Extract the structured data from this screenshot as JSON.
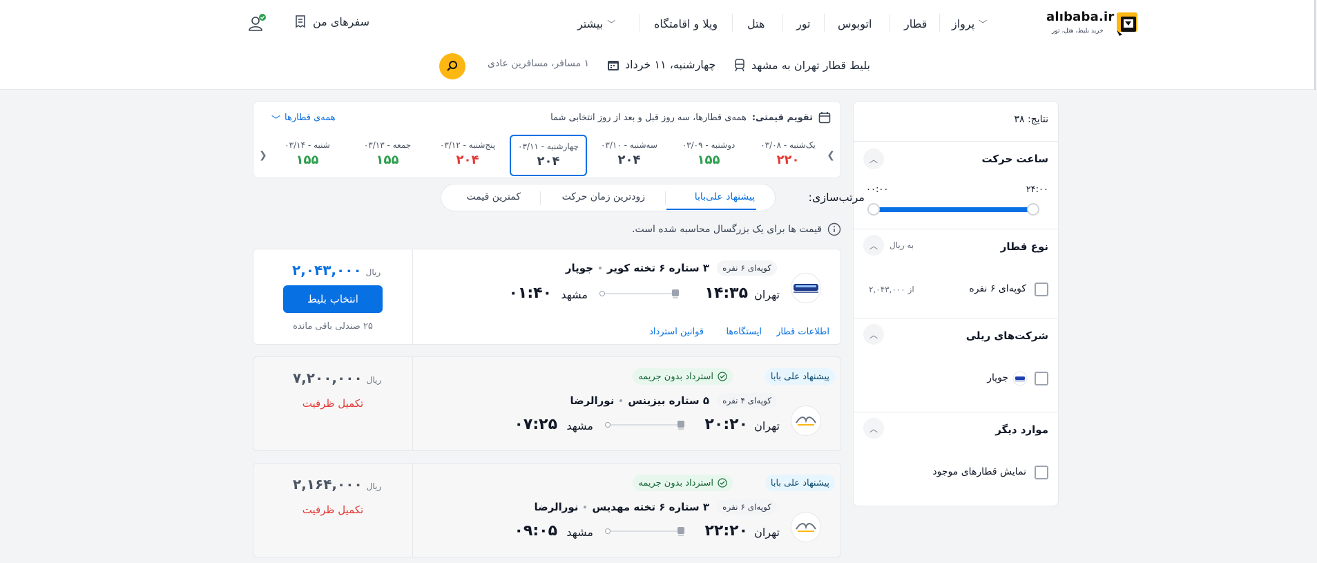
{
  "header": {
    "logo_text": "alıbaba.ir",
    "logo_sub": "خرید بلیط، هتل، تور",
    "nav": [
      "پرواز",
      "قطار",
      "اتوبوس",
      "تور",
      "هتل",
      "ویلا و اقامتگاه",
      "بیشتر"
    ],
    "my_trips": "سفرهای من"
  },
  "search": {
    "title": "بلیط قطار تهران به مشهد",
    "date": "چهارشنبه، ۱۱ خرداد",
    "passengers": "۱ مسافر، مسافرین عادی"
  },
  "filters": {
    "results": "نتایج: ۳۸",
    "depart_time": {
      "title": "ساعت حرکت",
      "from": "۰۰:۰۰",
      "to": "۲۴:۰۰"
    },
    "train_type": {
      "title": "نوع قطار",
      "unit": "به ریال",
      "option": "کوپه‌ای ۶ نفره",
      "from_price": "از ۲,۰۴۳,۰۰۰"
    },
    "companies": {
      "title": "شرکت‌های ریلی",
      "option": "جوپار"
    },
    "other": {
      "title": "موارد دیگر",
      "option": "نمایش قطارهای موجود"
    }
  },
  "calendar": {
    "title_bold": "تقویم قیمتی:",
    "title_rest": "همه‌ی قطارها، سه روز قبل و بعد از روز انتخابی شما",
    "all_trains": "همه‌ی قطارها",
    "days": [
      {
        "label": "یک‌شنبه - ۰۳/۰۸",
        "price": "۲۲۰",
        "color": "#e53935"
      },
      {
        "label": "دوشنبه - ۰۳/۰۹",
        "price": "۱۵۵",
        "color": "#2e9e4f"
      },
      {
        "label": "سه‌شنبه - ۰۳/۱۰",
        "price": "۲۰۴",
        "color": "#374151"
      },
      {
        "label": "چهارشنبه - ۰۳/۱۱",
        "price": "۲۰۴",
        "color": "#374151"
      },
      {
        "label": "پنج‌شنبه - ۰۳/۱۲",
        "price": "۲۰۴",
        "color": "#e53935"
      },
      {
        "label": "جمعه - ۰۳/۱۳",
        "price": "۱۵۵",
        "color": "#2e9e4f"
      },
      {
        "label": "شنبه - ۰۳/۱۴",
        "price": "۱۵۵",
        "color": "#2e9e4f"
      }
    ]
  },
  "sort": {
    "label": "مرتب‌سازی:",
    "options": [
      "پیشنهاد علی‌بابا",
      "زودترین زمان حرکت",
      "کمترین قیمت"
    ]
  },
  "note": "قیمت ها برای یک بزرگسال محاسبه شده است.",
  "tickets": [
    {
      "coupe": "کوپه‌ای ۶ نفره",
      "class": "۳ ستاره ۶ تخته کویر",
      "company": "جوپار",
      "origin": "تهران",
      "depart": "۱۴:۳۵",
      "dest": "مشهد",
      "arrive": "۰۱:۴۰",
      "price": "۲,۰۴۳,۰۰۰",
      "unit": "ریال",
      "button": "انتخاب بلیط",
      "seats": "۲۵ صندلی باقی مانده",
      "links": [
        "اطلاعات قطار",
        "ایستگاه‌ها",
        "قوانین استرداد"
      ]
    },
    {
      "badge_offer": "پیشنهاد علی بابا",
      "badge_refund": "استرداد بدون جریمه",
      "coupe": "کوپه‌ای ۴ نفره",
      "class": "۵ ستاره بیزینس",
      "company": "نورالرضا",
      "origin": "تهران",
      "depart": "۲۰:۲۰",
      "dest": "مشهد",
      "arrive": "۰۷:۲۵",
      "price": "۷,۲۰۰,۰۰۰",
      "unit": "ریال",
      "status": "تکمیل ظرفیت"
    },
    {
      "badge_offer": "پیشنهاد علی بابا",
      "badge_refund": "استرداد بدون جریمه",
      "coupe": "کوپه‌ای ۶ نفره",
      "class": "۳ ستاره ۶ تخته مهدیس",
      "company": "نورالرضا",
      "origin": "تهران",
      "depart": "۲۲:۲۰",
      "dest": "مشهد",
      "arrive": "۰۹:۰۵",
      "price": "۲,۱۶۴,۰۰۰",
      "unit": "ریال",
      "status": "تکمیل ظرفیت"
    }
  ]
}
